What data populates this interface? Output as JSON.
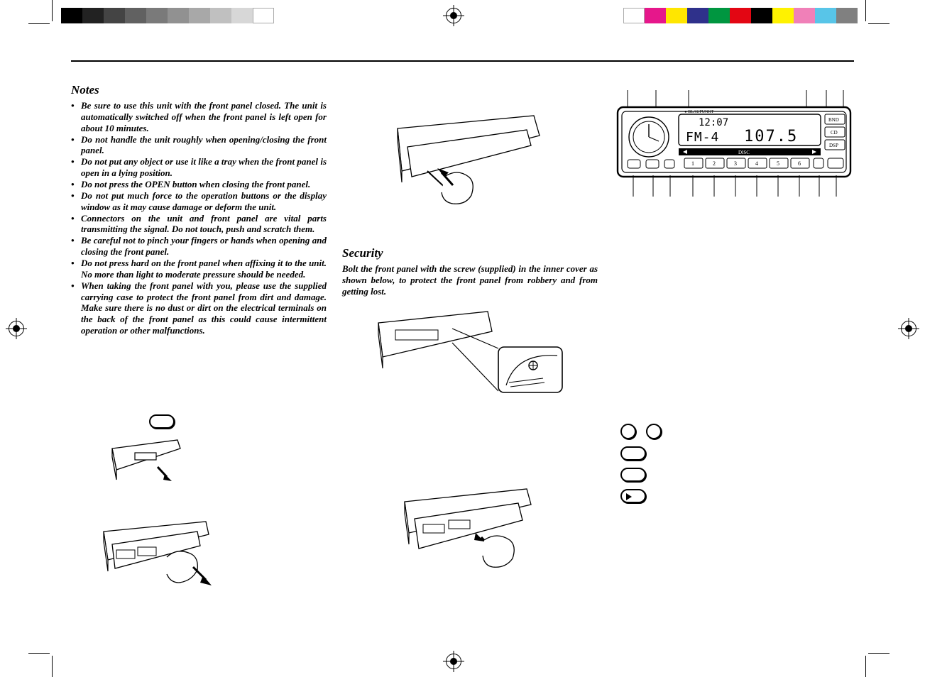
{
  "headings": {
    "notes": "Notes",
    "security": "Security"
  },
  "notes_items": [
    "Be sure to use this unit with the front panel closed. The unit is automatically switched off when the front panel is left open for about 10 minutes.",
    "Do not handle the unit roughly when opening/closing the front panel.",
    "Do not put any object or use it like a tray when the front panel is open in a lying position.",
    "Do not press the OPEN button when closing the front panel.",
    "Do not put much force to the operation buttons or the display window as it may cause damage or deform the unit.",
    "Connectors on the unit and front panel are vital parts transmitting the signal. Do not touch, push and scratch them.",
    "Be careful not to pinch your fingers or hands when opening and closing the front panel.",
    "Do not press hard on the front panel when affixing it to the unit. No more than light to moderate pressure should be needed.",
    "When taking the front panel with you, please use the supplied carrying case to protect the front panel from dirt and damage. Make sure there is no dust or dirt on the electrical terminals on the back of the front panel as this could cause intermittent operation or other malfunctions."
  ],
  "security_text": "Bolt the front panel with the screw (supplied) in the inner cover as shown below, to protect the front panel from robbery and from getting lost.",
  "device": {
    "brand": "BLAUPUNKT",
    "display_top": "12:07",
    "display_bottom_left": "FM-4",
    "display_bottom_right": "107.5",
    "strip_center": "DISC",
    "side_buttons": [
      "BND",
      "CD",
      "DSP"
    ],
    "preset_buttons": [
      "1",
      "2",
      "3",
      "4",
      "5",
      "6"
    ]
  },
  "swatches_left": [
    "#000000",
    "#222222",
    "#444444",
    "#616161",
    "#7a7a7a",
    "#919191",
    "#a8a8a8",
    "#c0c0c0",
    "#d7d7d7",
    "#ffffff"
  ],
  "swatches_right": [
    "#ffffff",
    "#e6178b",
    "#ffe600",
    "#2f318b",
    "#009640",
    "#e30613",
    "#000000",
    "#fff200",
    "#f080b8",
    "#58c5e8",
    "#808080"
  ]
}
